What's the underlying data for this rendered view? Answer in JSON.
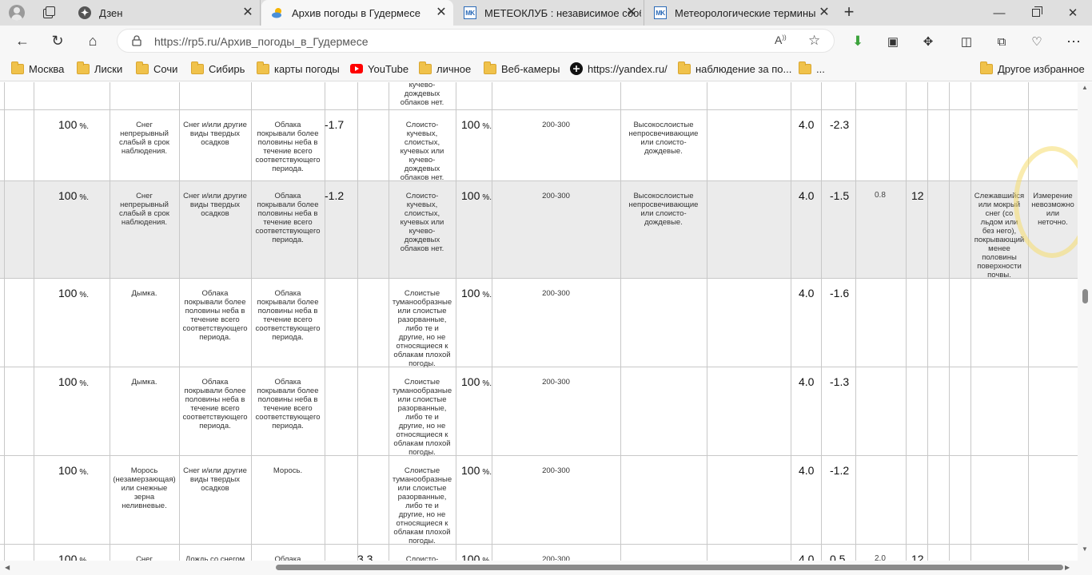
{
  "tabs": [
    {
      "title": "Дзен",
      "active": false
    },
    {
      "title": "Архив погоды в Гудермесе",
      "active": true
    },
    {
      "title": "МЕТЕОКЛУБ : независимое сооб",
      "active": false
    },
    {
      "title": "Метеорологические термины",
      "active": false
    }
  ],
  "address": {
    "url": "https://rp5.ru/Архив_погоды_в_Гудермесе"
  },
  "bookmarks": [
    "Москва",
    "Лиски",
    "Сочи",
    "Сибирь",
    "карты погоды",
    "YouTube",
    "личное",
    "Веб-камеры",
    "https://yandex.ru/",
    "наблюдение за по...",
    "...",
    "Другое избранное"
  ],
  "unit_pct": "%.",
  "rows": [
    {
      "c1": "",
      "c2": "",
      "c3": "",
      "c4": "",
      "c5": "",
      "c6": "",
      "c7": "кучево-\nдождевых\nоблаков нет.",
      "c8": "",
      "c9": "",
      "c10": "",
      "c11": "",
      "c12": "",
      "c13": "",
      "c14": "",
      "c15": "",
      "c16": "",
      "c17": ""
    },
    {
      "pct": "100",
      "c2": "Снег\nнепрерывный\nслабый в срок\nнаблюдения.",
      "c3": "Снег и/или другие\nвиды твердых\nосадков",
      "c4": "Облака\nпокрывали более\nполовины неба в\nтечение всего\nсоответствующего\nпериода.",
      "c5": "-1.7",
      "c7": "Слоисто-\nкучевых,\nслоистых,\nкучевых или\nкучево-\nдождевых\nоблаков нет.",
      "pct2": "100",
      "c9": "200-300",
      "c10": "Высокослоистые\nнепросвечивающие\nили слоисто-\nдождевые.",
      "c12": "4.0",
      "c13": "-2.3"
    },
    {
      "pct": "100",
      "c2": "Снег\nнепрерывный\nслабый в срок\nнаблюдения.",
      "c3": "Снег и/или другие\nвиды твердых\nосадков",
      "c4": "Облака\nпокрывали более\nполовины неба в\nтечение всего\nсоответствующего\nпериода.",
      "c5": "-1.2",
      "c7": "Слоисто-\nкучевых,\nслоистых,\nкучевых или\nкучево-\nдождевых\nоблаков нет.",
      "pct2": "100",
      "c9": "200-300",
      "c10": "Высокослоистые\nнепросвечивающие\nили слоисто-\nдождевые.",
      "c12": "4.0",
      "c13": "-1.5",
      "c14": "0.8",
      "c15": "12",
      "c17": "Слежавшийся\nили мокрый\nснег (со\nльдом или\nбез него),\nпокрывающий\nменее\nполовины\nповерхности\nпочвы.",
      "c18": "Измерение\nневозможно\nили\nнеточно."
    },
    {
      "pct": "100",
      "c2": "Дымка.",
      "c3": "Облака\nпокрывали более\nполовины неба в\nтечение всего\nсоответствующего\nпериода.",
      "c4": "Облака\nпокрывали более\nполовины неба в\nтечение всего\nсоответствующего\nпериода.",
      "c7": "Слоистые\nтуманообразные\nили слоистые\nразорванные,\nлибо те и\nдругие, но не\nотносящиеся к\nоблакам плохой\nпогоды.",
      "pct2": "100",
      "c9": "200-300",
      "c12": "4.0",
      "c13": "-1.6"
    },
    {
      "pct": "100",
      "c2": "Дымка.",
      "c3": "Облака\nпокрывали более\nполовины неба в\nтечение всего\nсоответствующего\nпериода.",
      "c4": "Облака\nпокрывали более\nполовины неба в\nтечение всего\nсоответствующего\nпериода.",
      "c7": "Слоистые\nтуманообразные\nили слоистые\nразорванные,\nлибо те и\nдругие, но не\nотносящиеся к\nоблакам плохой\nпогоды.",
      "pct2": "100",
      "c9": "200-300",
      "c12": "4.0",
      "c13": "-1.3"
    },
    {
      "pct": "100",
      "c2": "Морось\n(незамерзающая)\nили снежные\nзерна\nнеливневые.",
      "c3": "Снег и/или другие\nвиды твердых\nосадков",
      "c4": "Морось.",
      "c7": "Слоистые\nтуманообразные\nили слоистые\nразорванные,\nлибо те и\nдругие, но не\nотносящиеся к\nоблакам плохой\nпогоды.",
      "pct2": "100",
      "c9": "200-300",
      "c12": "4.0",
      "c13": "-1.2"
    },
    {
      "pct": "100",
      "c2": "Снег",
      "c3": "Дождь со снегом",
      "c4": "Облака",
      "c6": "3.3",
      "c7": "Слоисто-",
      "pct2": "100",
      "c9": "200-300",
      "c12": "4.0",
      "c13": "0.5",
      "c14": "2.0",
      "c15": "12"
    }
  ]
}
